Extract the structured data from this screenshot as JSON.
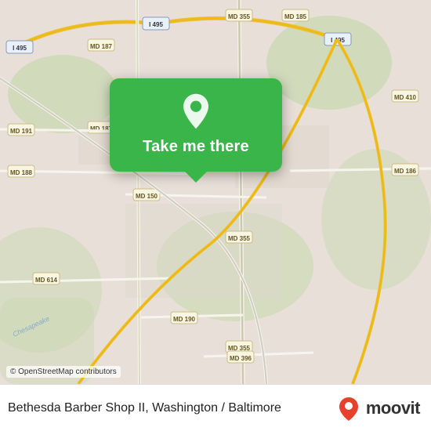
{
  "map": {
    "attribution": "© OpenStreetMap contributors",
    "center_lat": 38.98,
    "center_lng": -77.1,
    "zoom": 12
  },
  "popup": {
    "button_label": "Take me there"
  },
  "footer": {
    "place_name": "Bethesda Barber Shop II, Washington / Baltimore",
    "brand_name": "moovit"
  },
  "roads": {
    "labels": [
      "I 495",
      "I 495",
      "I 495",
      "MD 187",
      "MD 187",
      "MD 355",
      "MD 355",
      "MD 355",
      "MD 185",
      "MD 191",
      "MD 188",
      "MD 186",
      "MD 410",
      "MD 150",
      "MD 614",
      "MD 190",
      "MD 396"
    ]
  }
}
